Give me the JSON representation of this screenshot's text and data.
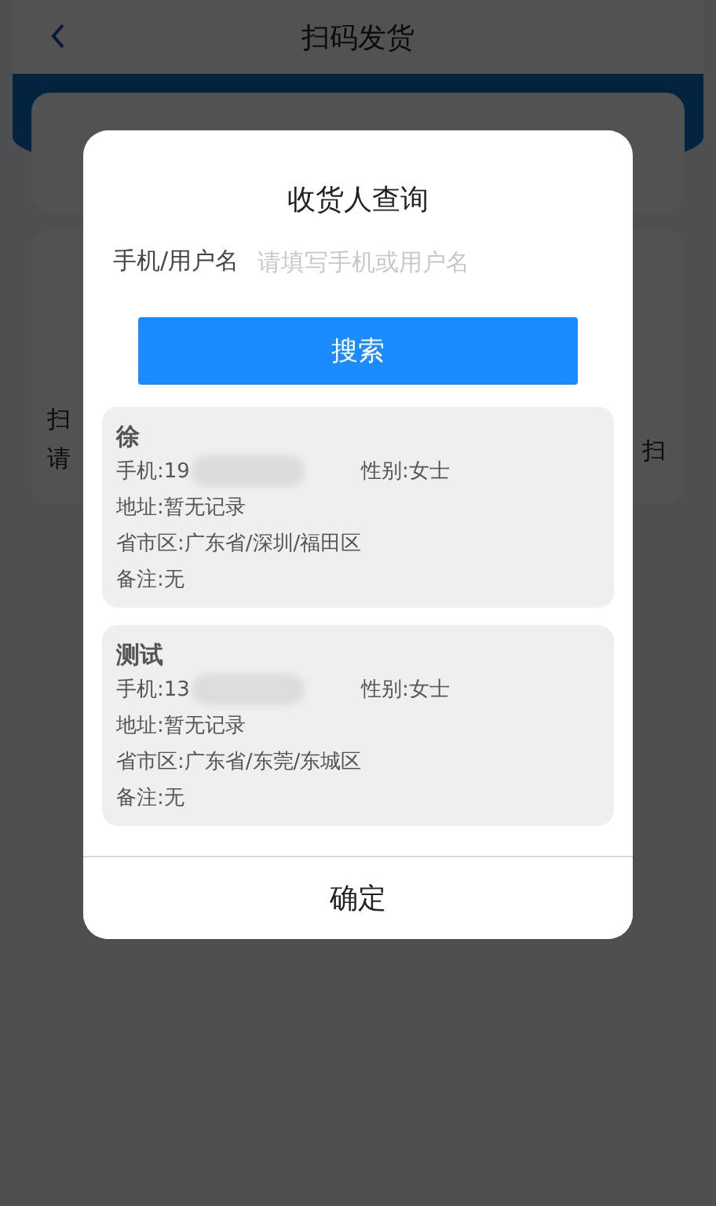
{
  "header": {
    "title": "扫码发货"
  },
  "background": {
    "left_labels": [
      "扫",
      "请"
    ],
    "right_labels": [
      "扫"
    ]
  },
  "dialog": {
    "title": "收货人查询",
    "field": {
      "label": "手机/用户名",
      "placeholder": "请填写手机或用户名"
    },
    "search_button": "搜索",
    "results": [
      {
        "name": "徐",
        "phone": "手机:19",
        "gender": "性别:女士",
        "address": "地址:暂无记录",
        "region": "省市区:广东省/深圳/福田区",
        "note": "备注:无"
      },
      {
        "name": "测试",
        "phone": "手机:13",
        "gender": "性别:女士",
        "address": "地址:暂无记录",
        "region": "省市区:广东省/东莞/东城区",
        "note": "备注:无"
      }
    ],
    "confirm_button": "确定"
  }
}
